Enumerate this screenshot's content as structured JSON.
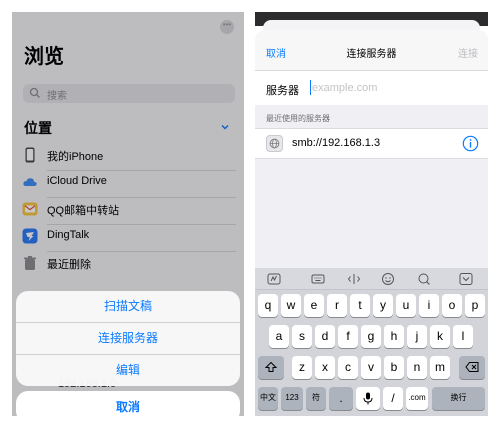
{
  "left": {
    "browse_title": "浏览",
    "search_placeholder": "搜索",
    "locations_title": "位置",
    "locations": [
      {
        "label": "我的iPhone",
        "icon": "iphone-icon",
        "color": "#6d6d72"
      },
      {
        "label": "iCloud Drive",
        "icon": "icloud-icon",
        "color": "#3e8ef7"
      },
      {
        "label": "QQ邮箱中转站",
        "icon": "qq-mail-icon",
        "color": "#f6c343"
      },
      {
        "label": "DingTalk",
        "icon": "dingtalk-icon",
        "color": "#2e7cf6"
      },
      {
        "label": "最近删除",
        "icon": "trash-icon",
        "color": "#8e8e93"
      }
    ],
    "behind_text": "192.168.1.0",
    "action_sheet": {
      "scan": "扫描文稿",
      "connect": "连接服务器",
      "edit": "编辑",
      "cancel": "取消"
    }
  },
  "right": {
    "nav": {
      "cancel": "取消",
      "title": "连接服务器",
      "connect": "连接"
    },
    "server_label": "服务器",
    "server_placeholder": "example.com",
    "recent_header": "最近使用的服务器",
    "recent_server": "smb://192.168.1.3",
    "keyboard": {
      "row1": [
        "q",
        "w",
        "e",
        "r",
        "t",
        "y",
        "u",
        "i",
        "o",
        "p"
      ],
      "row2": [
        "a",
        "s",
        "d",
        "f",
        "g",
        "h",
        "j",
        "k",
        "l"
      ],
      "row3": [
        "z",
        "x",
        "c",
        "v",
        "b",
        "n",
        "m"
      ],
      "lang_key": "中文",
      "num_key": "123",
      "sym_key": "符",
      "slash_key": "/",
      "com_key": ".com",
      "return_key": "换行"
    }
  },
  "colors": {
    "accent": "#0a7aff",
    "keyboard_bg": "#d2d4da"
  }
}
